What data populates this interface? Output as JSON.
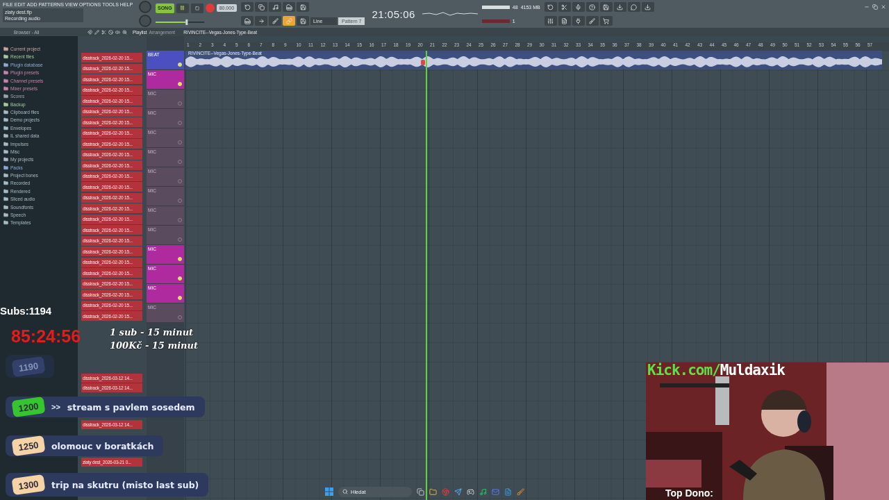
{
  "menu": [
    "FILE",
    "EDIT",
    "ADD",
    "PATTERNS",
    "VIEW",
    "OPTIONS",
    "TOOLS",
    "HELP"
  ],
  "hint": {
    "title": "zlaty dest.flp",
    "message": "Recording audio"
  },
  "transport": {
    "mode": "SONG",
    "recording": true,
    "tempo": "80.000",
    "clock": "21:05:06"
  },
  "master": {
    "level": 0.64
  },
  "snap": "Line",
  "pattern": "Pattern 7",
  "monitor": {
    "memory": "4153 MB",
    "cpu": "48",
    "voices": "1"
  },
  "browser": {
    "title": "Browser - All",
    "items": [
      {
        "label": "Current project",
        "color": "#c9a3a0"
      },
      {
        "label": "Recent files",
        "color": "#a9c99d"
      },
      {
        "label": "Plugin database",
        "color": "#8ea9d2"
      },
      {
        "label": "Plugin presets",
        "color": "#c583ad"
      },
      {
        "label": "Channel presets",
        "color": "#c583ad"
      },
      {
        "label": "Mixer presets",
        "color": "#c583ad"
      },
      {
        "label": "Scores",
        "color": "#9aa6ad"
      },
      {
        "label": "Backup",
        "color": "#a9c99d"
      },
      {
        "label": "Clipboard files",
        "color": "#a9bcc6"
      },
      {
        "label": "Demo projects",
        "color": "#a9bcc6"
      },
      {
        "label": "Envelopes",
        "color": "#a9bcc6"
      },
      {
        "label": "IL shared data",
        "color": "#a9bcc6"
      },
      {
        "label": "Impulses",
        "color": "#a9bcc6"
      },
      {
        "label": "Misc",
        "color": "#a9bcc6"
      },
      {
        "label": "My projects",
        "color": "#a9bcc6"
      },
      {
        "label": "Packs",
        "color": "#8ea9d2"
      },
      {
        "label": "Project bones",
        "color": "#a9bcc6"
      },
      {
        "label": "Recorded",
        "color": "#a9bcc6"
      },
      {
        "label": "Rendered",
        "color": "#a9bcc6"
      },
      {
        "label": "Sliced audio",
        "color": "#a9bcc6"
      },
      {
        "label": "Soundfonts",
        "color": "#a9bcc6"
      },
      {
        "label": "Speech",
        "color": "#a9bcc6"
      },
      {
        "label": "Templates",
        "color": "#a9bcc6"
      }
    ]
  },
  "playlist": {
    "title": "Playlist",
    "subtitle": "Arrangement",
    "name": "RIVINCITE--Vegas-Jones-Type-Beat",
    "clip": "RIVINCITE--Vegas-Jones-Type-Beat",
    "ruler": [
      "1",
      "2",
      "3",
      "4",
      "5",
      "6",
      "7",
      "8",
      "9",
      "10",
      "11",
      "12",
      "13",
      "14",
      "15",
      "16",
      "17",
      "18",
      "19",
      "20",
      "21",
      "22",
      "23",
      "24",
      "25",
      "26",
      "27",
      "28",
      "29",
      "30",
      "31",
      "32",
      "33",
      "34",
      "35",
      "36",
      "37",
      "38",
      "39",
      "40",
      "41",
      "42",
      "43",
      "44",
      "45",
      "46",
      "47",
      "48",
      "49",
      "50",
      "51",
      "52",
      "53",
      "54",
      "55",
      "56",
      "57"
    ]
  },
  "clips": [
    "disstrack_2026-02-20 15...",
    "disstrack_2026-02-20 15...",
    "disstrack_2026-02-20 15...",
    "disstrack_2026-02-20 15...",
    "disstrack_2026-02-20 15...",
    "disstrack_2026-02-20 15...",
    "disstrack_2026-02-20 15...",
    "disstrack_2026-02-20 15...",
    "disstrack_2026-02-20 15...",
    "disstrack_2026-02-20 15...",
    "disstrack_2026-02-20 15...",
    "disstrack_2026-02-20 15...",
    "disstrack_2026-02-20 15...",
    "disstrack_2026-02-20 15...",
    "disstrack_2026-02-20 15...",
    "disstrack_2026-02-20 15...",
    "disstrack_2026-02-20 15...",
    "disstrack_2026-02-20 15...",
    "disstrack_2026-02-20 15...",
    "disstrack_2026-02-20 15...",
    "disstrack_2026-02-20 15...",
    "disstrack_2026-02-20 15...",
    "disstrack_2026-02-20 15...",
    "disstrack_2026-02-20 15...",
    "disstrack_2026-02-20 15..."
  ],
  "lower_clips": [
    "disstrack_2026-03-12 14...",
    "disstrack_2026-03-12 14...",
    "disstrack_2026-03-12 14...",
    "zlaty dest_2026-03-21 0..."
  ],
  "tracks": [
    {
      "name": "BEAT",
      "color": "#4b4fbf"
    },
    {
      "name": "MIC",
      "color": "#b02a9f"
    },
    {
      "name": "MIC",
      "color": "#5b4b5e"
    },
    {
      "name": "MIC",
      "color": "#5b4b5e"
    },
    {
      "name": "MIC",
      "color": "#5b4b5e"
    },
    {
      "name": "MIC",
      "color": "#5b4b5e"
    },
    {
      "name": "MIC",
      "color": "#5b4b5e"
    },
    {
      "name": "MIC",
      "color": "#5b4b5e"
    },
    {
      "name": "MIC",
      "color": "#5b4b5e"
    },
    {
      "name": "MIC",
      "color": "#5b4b5e"
    },
    {
      "name": "MIC",
      "color": "#b02a9f"
    },
    {
      "name": "MIC",
      "color": "#b02a9f"
    },
    {
      "name": "MIC",
      "color": "#b02a9f"
    },
    {
      "name": "MIC",
      "color": "#5b4b5e"
    }
  ],
  "stream": {
    "subs": "Subs:1194",
    "timer": "85:24:56",
    "rates": [
      "1 sub - 15 minut",
      "100Kč - 15 minut"
    ],
    "goals": [
      {
        "kind": "done",
        "goal": "1190"
      },
      {
        "kind": "current",
        "goal": "1200",
        "marker": ">>",
        "text": "stream s pavlem sosedem"
      },
      {
        "kind": "upcoming",
        "goal": "1250",
        "text": "olomouc v boratkách"
      },
      {
        "kind": "upcoming",
        "goal": "1300",
        "text": "trip na skutru (misto last sub)"
      }
    ],
    "channel": {
      "site": "Kick.com/",
      "user": "Muldaxik"
    },
    "top_donor": "Top Dono:"
  },
  "taskbar": {
    "search": "Hledat"
  }
}
